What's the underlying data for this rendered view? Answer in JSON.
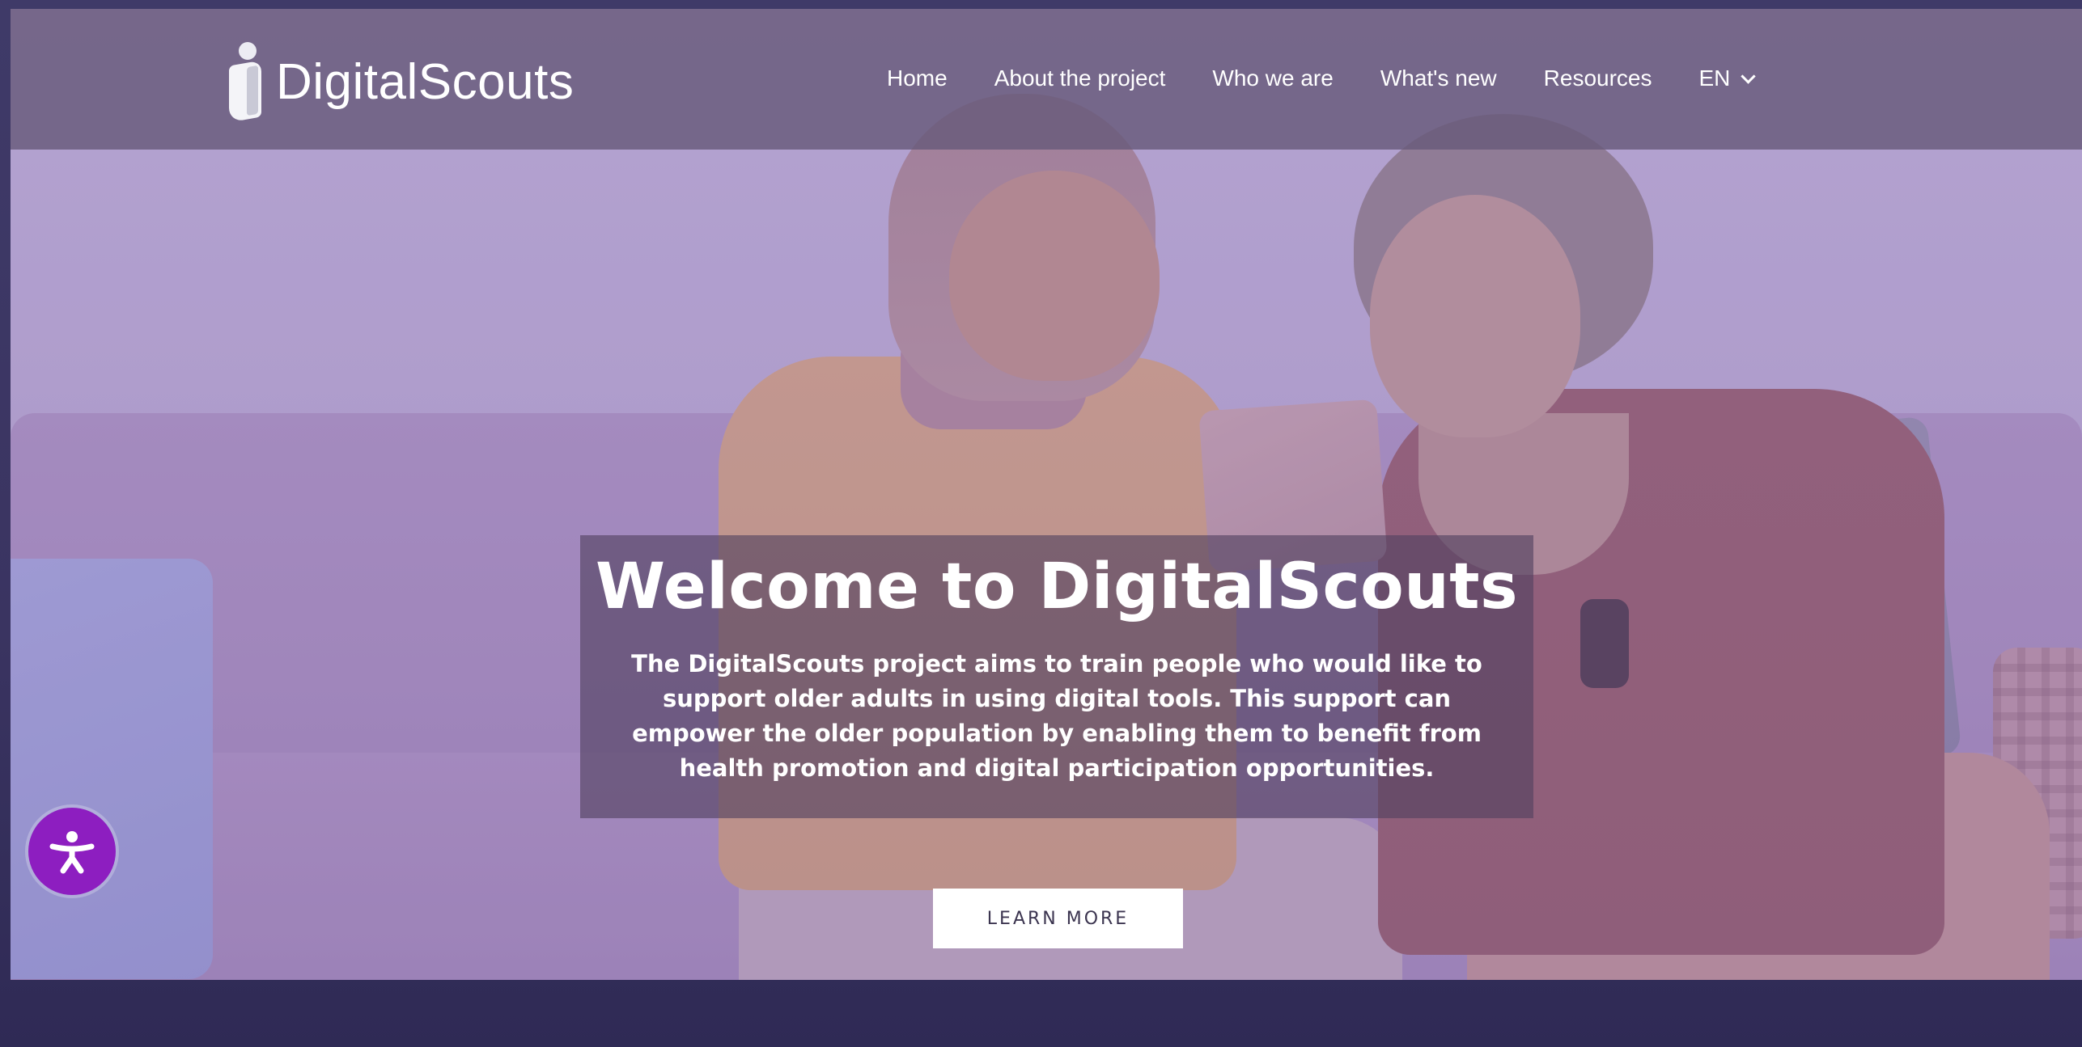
{
  "header": {
    "logo_text": "DigitalScouts",
    "nav": [
      {
        "label": "Home"
      },
      {
        "label": "About the project"
      },
      {
        "label": "Who we are"
      },
      {
        "label": "What's new"
      },
      {
        "label": "Resources"
      }
    ],
    "language": "EN"
  },
  "hero": {
    "title": "Welcome to DigitalScouts",
    "description": "The DigitalScouts project aims to train people who would like to support older adults in using digital tools. This support can empower the older population by enabling them to benefit from health promotion and digital participation opportunities.",
    "cta_label": "LEARN MORE"
  },
  "icons": {
    "logo": "logo-icon",
    "language_chevron": "chevron-down-icon",
    "accessibility": "accessibility-icon"
  },
  "colors": {
    "accessibility_button": "#8d1ec0",
    "header_overlay": "#685a7a",
    "page_background": "#3a3461"
  }
}
